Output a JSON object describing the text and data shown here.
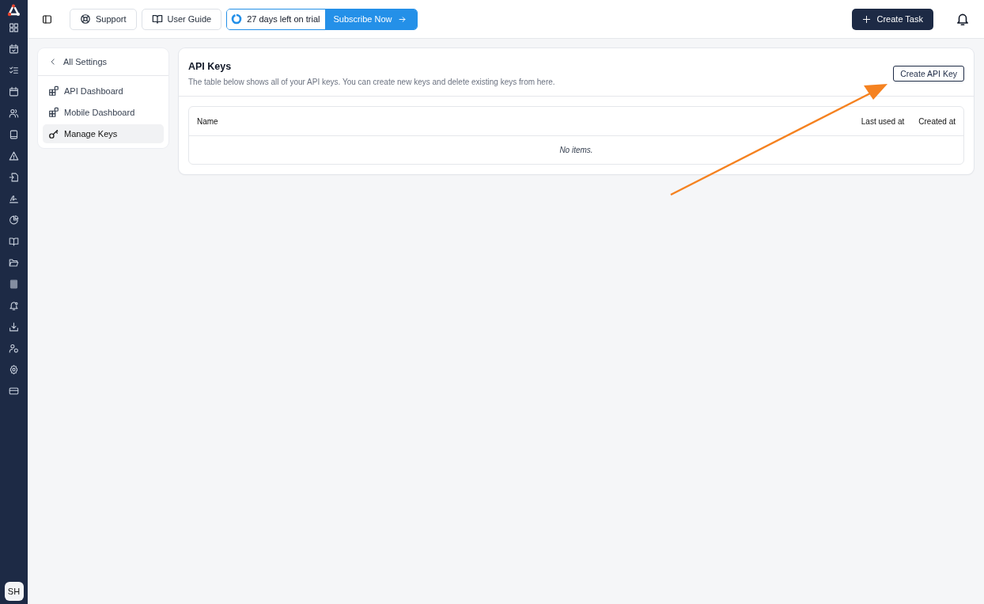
{
  "rail": {
    "avatar": "SH"
  },
  "topbar": {
    "buttons": [
      {
        "label": "Support",
        "kind": "support"
      },
      {
        "label": "User Guide",
        "kind": "guide"
      }
    ],
    "trial": {
      "text": "27 days left on trial",
      "action": "Subscribe Now"
    },
    "create_button": "Create Task"
  },
  "settings_nav": {
    "back": "All Settings",
    "items": [
      {
        "label": "API Dashboard",
        "kind": "dashboard",
        "selected": false
      },
      {
        "label": "Mobile Dashboard",
        "kind": "dashboard",
        "selected": false
      },
      {
        "label": "Manage Keys",
        "kind": "key",
        "selected": true
      }
    ]
  },
  "panel": {
    "title": "API Keys",
    "description": "The table below shows all of your API keys. You can create new keys and delete existing keys from here.",
    "button": "Create API Key",
    "table": {
      "columns": [
        "Name",
        "Last used at",
        "Created at"
      ],
      "empty": "No items."
    }
  }
}
